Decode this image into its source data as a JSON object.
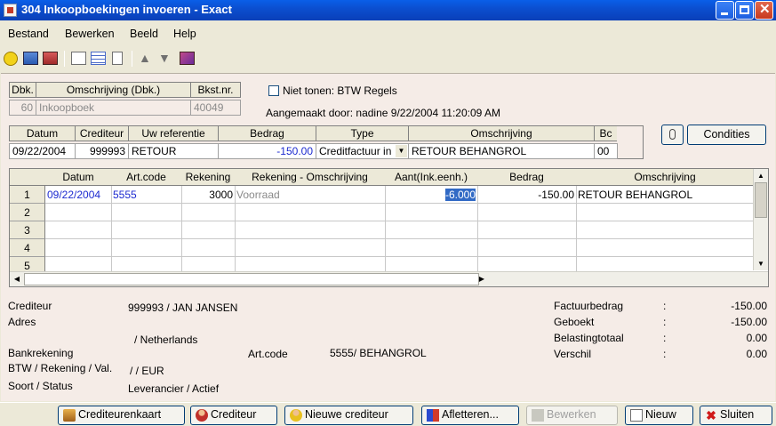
{
  "window": {
    "title": "304 Inkoopboekingen invoeren - Exact"
  },
  "menu": [
    {
      "label": "Bestand"
    },
    {
      "label": "Bewerken"
    },
    {
      "label": "Beeld"
    },
    {
      "label": "Help"
    }
  ],
  "header": {
    "cols": [
      "Dbk.",
      "Omschrijving (Dbk.)",
      "Bkst.nr."
    ],
    "values": {
      "dbk": "60",
      "omschrijving": "Inkoopboek",
      "bkst": "40049"
    },
    "checkbox_label": "Niet tonen: BTW Regels",
    "created_by": "Aangemaakt door: nadine  9/22/2004 11:20:09 AM"
  },
  "booking": {
    "cols": [
      "Datum",
      "Crediteur",
      "Uw referentie",
      "Bedrag",
      "Type",
      "Omschrijving",
      "Bc"
    ],
    "values": {
      "datum": "09/22/2004",
      "crediteur": "999993",
      "referentie": "RETOUR",
      "bedrag": "-150.00",
      "type": "Creditfactuur in",
      "omschrijving": "RETOUR BEHANGROL",
      "bc": "00"
    },
    "condities_label": "Condities"
  },
  "grid": {
    "cols": [
      "Datum",
      "Art.code",
      "Rekening",
      "Rekening - Omschrijving",
      "Aant(Ink.eenh.)",
      "Bedrag",
      "Omschrijving"
    ],
    "rows": [
      {
        "n": "1",
        "datum": "09/22/2004",
        "artcode": "5555",
        "rekening": "3000",
        "rek_oms": "Voorraad",
        "aant": "-6.000",
        "bedrag": "-150.00",
        "oms": "RETOUR BEHANGROL"
      },
      {
        "n": "2"
      },
      {
        "n": "3"
      },
      {
        "n": "4"
      },
      {
        "n": "5"
      }
    ]
  },
  "info": {
    "crediteur_label": "Crediteur",
    "crediteur_value": "999993 / JAN JANSEN",
    "adres_label": "Adres",
    "adres_value": "/ Netherlands",
    "bank_label": "Bankrekening",
    "btw_label": "BTW / Rekening / Val.",
    "btw_value": "/  / EUR",
    "soort_label": "Soort / Status",
    "soort_value": "Leverancier / Actief",
    "artcode_label": "Art.code",
    "artcode_value": "5555/ BEHANGROL"
  },
  "totals": [
    {
      "label": "Factuurbedrag",
      "sep": ":",
      "value": "-150.00"
    },
    {
      "label": "Geboekt",
      "sep": ":",
      "value": "-150.00"
    },
    {
      "label": "Belastingtotaal",
      "sep": ":",
      "value": "0.00"
    },
    {
      "label": "Verschil",
      "sep": ":",
      "value": "0.00"
    }
  ],
  "buttons": [
    {
      "label": "Crediteurenkaart"
    },
    {
      "label": "Crediteur"
    },
    {
      "label": "Nieuwe crediteur"
    },
    {
      "label": "Afletteren..."
    },
    {
      "label": "Bewerken"
    },
    {
      "label": "Nieuw"
    },
    {
      "label": "Sluiten"
    }
  ],
  "colors": {
    "title_bar": "#0b4fd0",
    "panel": "#f5ece7",
    "link_blue": "#1c2ad0",
    "selection": "#316ac5"
  }
}
